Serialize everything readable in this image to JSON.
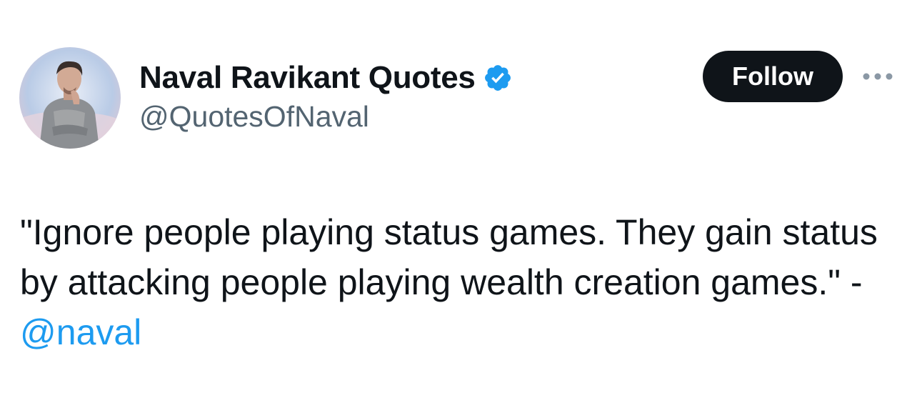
{
  "author": {
    "display_name": "Naval Ravikant Quotes",
    "handle": "@QuotesOfNaval",
    "verified": true,
    "avatar": "avatar-illustration"
  },
  "actions": {
    "follow_label": "Follow",
    "more_icon": "more-horizontal-icon"
  },
  "tweet": {
    "text": "\"Ignore people playing status games. They gain status by attacking people playing wealth creation games.\" -",
    "mention": "@naval"
  },
  "colors": {
    "text": "#0f1419",
    "secondary": "#536471",
    "accent": "#1d9bf0",
    "button_bg": "#0f1419"
  }
}
